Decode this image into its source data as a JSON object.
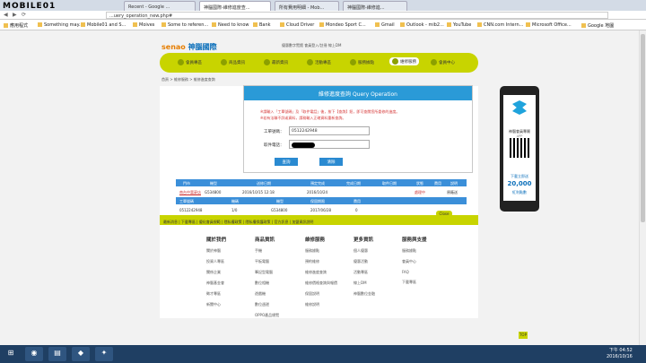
{
  "browser": {
    "tabs": [
      "Recent - Google ...",
      "神腦國際-維修進度查...",
      "所有費用明細 - Mob...",
      "神腦國際-維修進..."
    ],
    "url": "...uery_operation_new.php#",
    "bookmarks": [
      "應用程式",
      "Something may...",
      "Mobile01 and S...",
      "Moives",
      "Some to referen...",
      "Need to know",
      "Bank",
      "Cloud Driver",
      "Mondeo Sport C...",
      "Gmail",
      "Outlook - mib2...",
      "YouTube",
      "CNN.com Intern...",
      "Microsoft Office...",
      "Google 地圖"
    ]
  },
  "watermark": "MOBILE01",
  "site": {
    "logo_en": "senao",
    "logo_cn": "神腦國際",
    "header_links": "優惠數字覽館  會員登入/註冊  線上DM",
    "nav": [
      "會員專區",
      "商品資訊",
      "最新資訊",
      "活動專區",
      "服務據點",
      "維修服務",
      "會員中心"
    ],
    "breadcrumb": "首頁 > 維修服務 > 維修進度查詢"
  },
  "query": {
    "title": "維修進度查詢 Query Operation",
    "warn1": "※請輸入「工單號碼」及「取件電話」後，按下【查詢】鈕，即可查閱您所委修的進度。",
    "warn2": "※若有法聯不詳或資料，請務輸入正確資料重新查詢。",
    "order_label": "工單號碼：",
    "order_value": "0512242948",
    "phone_label": "取件電話：",
    "search_btn": "查詢",
    "clear_btn": "清除"
  },
  "table": {
    "header1": [
      "門市",
      "機型",
      "送修日期",
      "預定完成",
      "完成日期",
      "取件日期",
      "狀態",
      "費用",
      "說明"
    ],
    "row1": [
      "南台中富豪店",
      "G534800",
      "2016/10/15 12:18",
      "2016/10/24",
      "",
      "",
      "處理中",
      "",
      "原廠送"
    ],
    "header2": [
      "工單號碼",
      "機碼",
      "機型",
      "保固期限",
      "費用",
      ""
    ],
    "row2": [
      "0512242948",
      "1/0",
      "G534800",
      "2017/06/28",
      "0",
      ""
    ],
    "labels": [
      "客戶姓名",
      "電 話",
      "保固狀況",
      "保固到期"
    ],
    "remark": "11條週期不予費 20 應生",
    "phone_masked": "0935******"
  },
  "promo": {
    "line1": "神腦會員專屬",
    "line2": "APP",
    "line3": "下載立即送",
    "points": "20,000",
    "line4": "紅利點數"
  },
  "footer": {
    "close": "Close",
    "top_links": "最新消息 | 下載專區 | 優化會員規範 | 隱私權政策 | 隱私權保護政策 | 官方訊息 | 加盟資訊說明",
    "cols": [
      {
        "title": "關於我們",
        "items": [
          "關於神腦",
          "投資人專區",
          "關係企業",
          "神腦基金會",
          "徵才專區",
          "新聞中心"
        ]
      },
      {
        "title": "商品資訊",
        "items": [
          "手機",
          "平板電腦",
          "筆記型電腦",
          "數位相機",
          "遊戲機",
          "數位週邊",
          "OPPO產品總覽"
        ]
      },
      {
        "title": "維修服務",
        "items": [
          "服務據點",
          "預約維修",
          "維修進度查詢",
          "維修價格查詢與報價",
          "保固說明",
          "維修說明"
        ]
      },
      {
        "title": "更多資訊",
        "items": [
          "個人優惠",
          "優惠活動",
          "活動專區",
          "線上DM",
          "神腦數位金融"
        ]
      },
      {
        "title": "服務與支援",
        "items": [
          "服務據點",
          "會員中心",
          "FAQ",
          "下載專區"
        ]
      }
    ]
  },
  "taskbar": {
    "time": "下午 04:52",
    "date": "2016/10/16"
  }
}
